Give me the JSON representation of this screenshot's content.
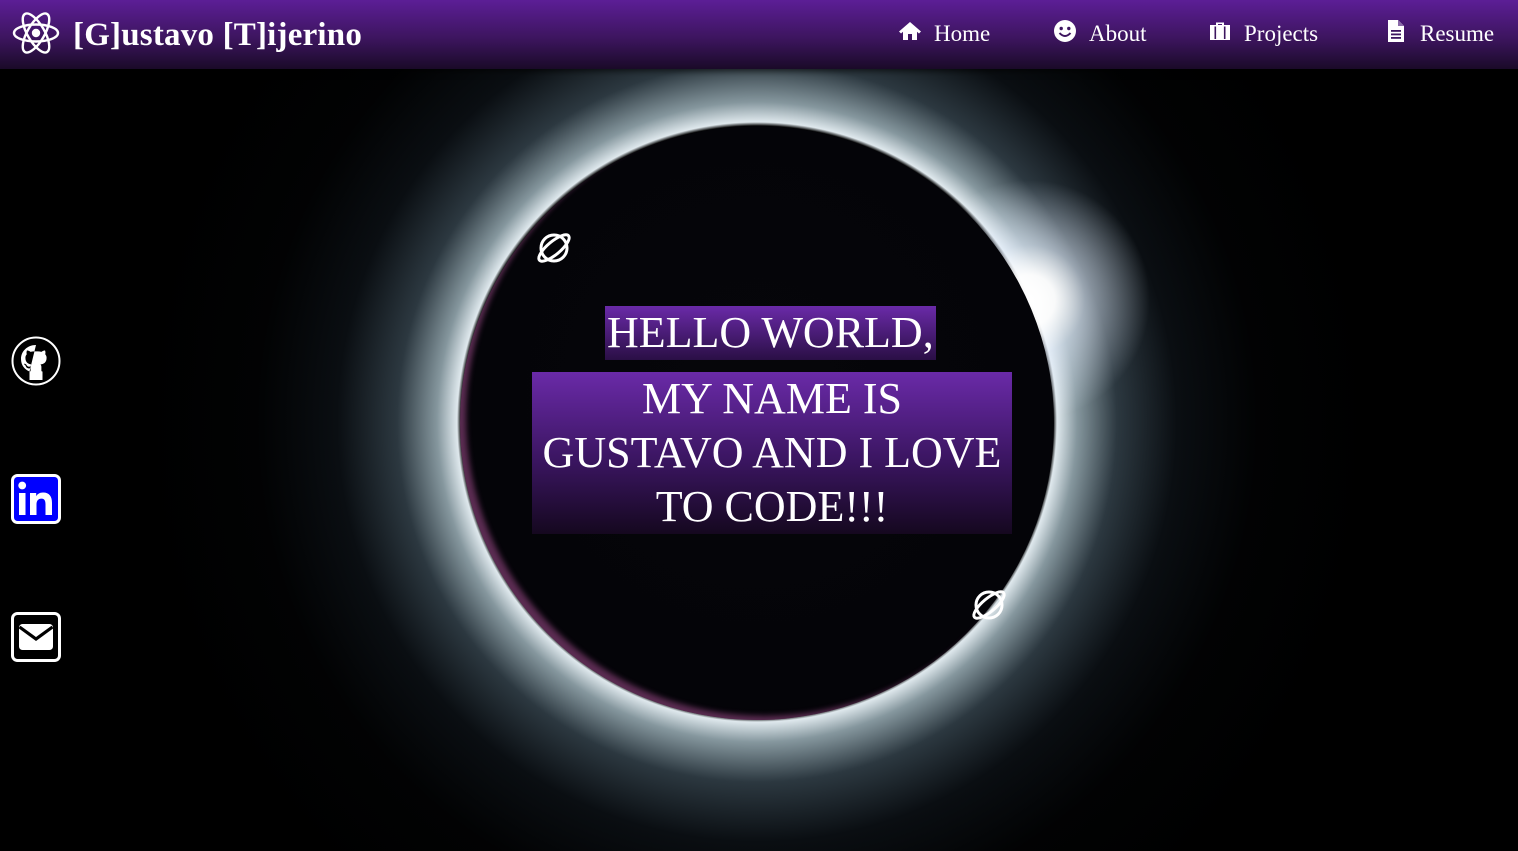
{
  "navbar": {
    "brand_icon": "react-atom-icon",
    "brand_title": "[G]ustavo [T]ijerino",
    "items": [
      {
        "label": "Home",
        "icon": "home-icon"
      },
      {
        "label": "About",
        "icon": "smiley-icon"
      },
      {
        "label": "Projects",
        "icon": "briefcase-icon"
      },
      {
        "label": "Resume",
        "icon": "document-icon"
      }
    ]
  },
  "hero": {
    "greeting": "HELLO WORLD,",
    "intro_lines": [
      "MY NAME IS",
      "GUSTAVO AND I LOVE",
      "TO CODE!!!"
    ],
    "decorations": [
      "planet-icon",
      "planet-icon"
    ]
  },
  "social": [
    {
      "name": "GitHub",
      "icon": "github-icon"
    },
    {
      "name": "LinkedIn",
      "icon": "linkedin-icon"
    },
    {
      "name": "Email",
      "icon": "email-icon"
    }
  ],
  "colors": {
    "navbar_gradient_top": "#5c1e96",
    "navbar_gradient_bottom": "#1a0a28",
    "highlight_purple": "#6a2aa8",
    "linkedin_blue": "#0000ff",
    "text": "#ffffff"
  }
}
